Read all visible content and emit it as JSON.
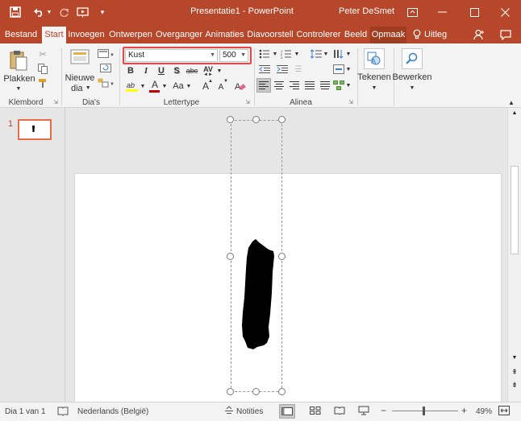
{
  "titlebar": {
    "title": "Presentatie1 - PowerPoint",
    "user": "Peter DeSmet",
    "icons": [
      "save-icon",
      "undo-icon",
      "redo-icon",
      "start-from-beginning-icon",
      "customize-toolbar-icon",
      "ribbon-display-options-icon",
      "minimize-icon",
      "maximize-icon",
      "close-icon"
    ]
  },
  "tabs": [
    "Bestand",
    "Start",
    "Invoegen",
    "Ontwerpen",
    "Overganger",
    "Animaties",
    "Diavoorstell",
    "Controlerer",
    "Beeld",
    "Opmaak",
    "Uitleg"
  ],
  "active_tab": "Start",
  "ribbon": {
    "clipboard": {
      "paste": "Plakken",
      "group": "Klembord"
    },
    "slides": {
      "new_line1": "Nieuwe",
      "new_line2": "dia",
      "group": "Dia's"
    },
    "font": {
      "name": "Kust",
      "size": "500",
      "bold": "B",
      "italic": "I",
      "underline": "U",
      "shadow": "S",
      "strike": "abc",
      "spacing": "AV",
      "case": "Aa",
      "grow": "A",
      "shrink": "A",
      "font_color": "A",
      "group": "Lettertype",
      "highlight_color": "#d03c3c",
      "font_color_value": "#c00000"
    },
    "paragraph": {
      "group": "Alinea"
    },
    "drawing": {
      "label": "Tekenen"
    },
    "editing": {
      "label": "Bewerken"
    }
  },
  "thumbnails": [
    {
      "number": "1",
      "selected": true
    }
  ],
  "status": {
    "slide": "Dia 1 van 1",
    "language": "Nederlands (België)",
    "notes": "Notities",
    "zoom": "49%"
  },
  "colors": {
    "accent": "#b7472a",
    "highlight_box": "#e84646",
    "thumb_border": "#e56d4a"
  }
}
